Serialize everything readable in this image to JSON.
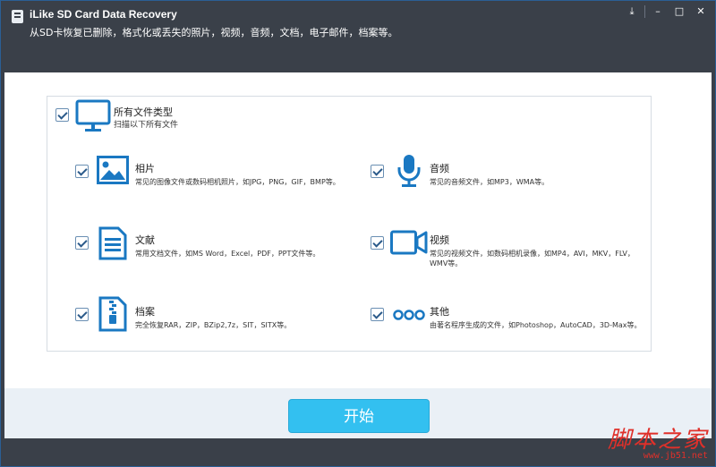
{
  "window": {
    "title": "iLike SD Card Data Recovery",
    "subtitle": "从SD卡恢复已删除，格式化或丢失的照片，视频，音频，文档，电子邮件，档案等。",
    "controls": {
      "download": "⤓",
      "minimize": "–",
      "maximize": "□",
      "close": "✕"
    }
  },
  "all_types": {
    "title": "所有文件类型",
    "desc": "扫描以下所有文件",
    "icon": "monitor-icon",
    "checked": true
  },
  "categories": {
    "photo": {
      "title": "相片",
      "desc": "常见的图像文件或数码相机照片，如JPG，PNG，GIF，BMP等。",
      "icon": "image-icon",
      "checked": true
    },
    "audio": {
      "title": "音频",
      "desc": "常见的音频文件，如MP3，WMA等。",
      "icon": "microphone-icon",
      "checked": true
    },
    "document": {
      "title": "文献",
      "desc": "常用文档文件，如MS Word，Excel，PDF，PPT文件等。",
      "icon": "document-icon",
      "checked": true
    },
    "video": {
      "title": "视频",
      "desc": "常见的视频文件，如数码相机录像，如MP4，AVI，MKV，FLV，WMV等。",
      "icon": "video-camera-icon",
      "checked": true
    },
    "archive": {
      "title": "档案",
      "desc": "完全恢复RAR，ZIP，BZip2,7z，SIT，SITX等。",
      "icon": "zip-archive-icon",
      "checked": true
    },
    "other": {
      "title": "其他",
      "desc": "由著名程序生成的文件，如Photoshop，AutoCAD，3D-Max等。",
      "icon": "more-dots-icon",
      "checked": true
    }
  },
  "start_button": "开始",
  "watermark": {
    "main": "脚本之家",
    "sub": "www.jb51.net"
  },
  "colors": {
    "accent": "#33c0f0",
    "icon_blue": "#1a78c2",
    "titlebar": "#3a4049"
  }
}
